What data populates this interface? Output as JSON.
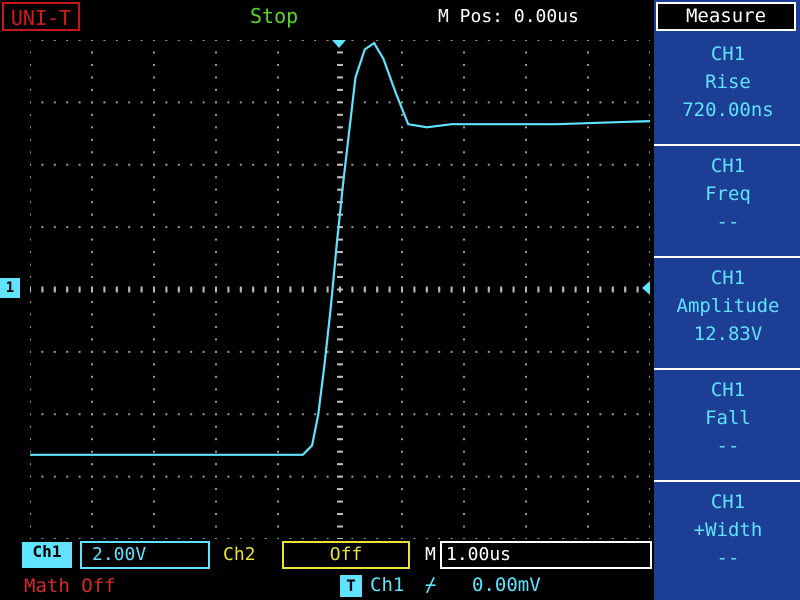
{
  "header": {
    "brand": "UNI-T",
    "run_state": "Stop",
    "m_pos": "M Pos: 0.00us"
  },
  "menu": {
    "title": "Measure",
    "items": [
      {
        "channel": "CH1",
        "name": "Rise",
        "value": "720.00ns"
      },
      {
        "channel": "CH1",
        "name": "Freq",
        "value": "--"
      },
      {
        "channel": "CH1",
        "name": "Amplitude",
        "value": "12.83V"
      },
      {
        "channel": "CH1",
        "name": "Fall",
        "value": "--"
      },
      {
        "channel": "CH1",
        "name": "+Width",
        "value": "--"
      }
    ]
  },
  "channels": {
    "ch1_label": "Ch1",
    "ch1_scale": "2.00V",
    "ch1_marker": "1",
    "ch2_label": "Ch2",
    "ch2_scale": "Off"
  },
  "timebase": {
    "label": "M",
    "scale": "1.00us"
  },
  "math": "Math Off",
  "trigger": {
    "icon": "T",
    "source": "Ch1",
    "edge": "⌿",
    "level": "0.00mV"
  },
  "colors": {
    "ch1": "#5fe3ff",
    "ch2": "#e8e23a",
    "menu_panel": "#1c3f95",
    "brand": "#d21b1b",
    "run_state": "#57d52b"
  },
  "chart_data": {
    "type": "line",
    "xlabel": "",
    "ylabel": "",
    "x_unit": "us",
    "y_unit": "V",
    "xlim": [
      -5.0,
      5.0
    ],
    "ylim": [
      -8.0,
      8.0
    ],
    "grid": true,
    "series": [
      {
        "x": [
          -5.0,
          -3.5,
          -2.0,
          -0.6,
          -0.45,
          -0.35,
          -0.25,
          -0.15,
          -0.05,
          0.05,
          0.15,
          0.25,
          0.4,
          0.55,
          0.7,
          0.9,
          1.1,
          1.4,
          1.8,
          2.5,
          3.5,
          5.0
        ],
        "y": [
          -5.3,
          -5.3,
          -5.3,
          -5.3,
          -5.0,
          -4.0,
          -2.4,
          -0.6,
          1.5,
          3.4,
          5.1,
          6.8,
          7.7,
          7.9,
          7.4,
          6.3,
          5.3,
          5.2,
          5.3,
          5.3,
          5.3,
          5.4
        ]
      }
    ]
  }
}
